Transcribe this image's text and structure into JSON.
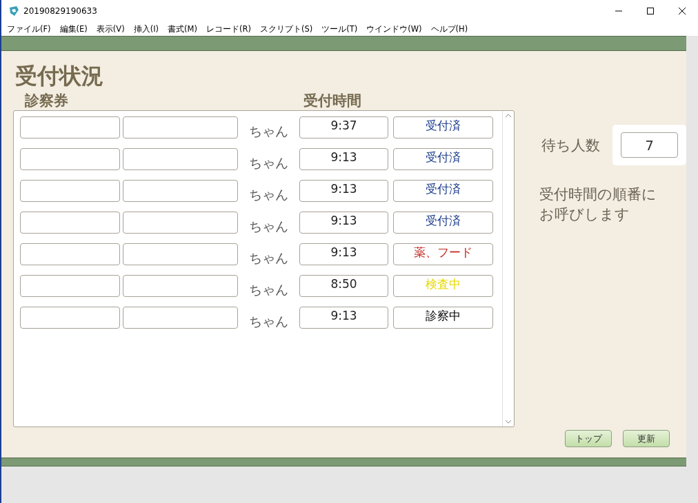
{
  "window": {
    "title": "20190829190633"
  },
  "menu": [
    "ファイル(F)",
    "編集(E)",
    "表示(V)",
    "挿入(I)",
    "書式(M)",
    "レコード(R)",
    "スクリプト(S)",
    "ツール(T)",
    "ウインドウ(W)",
    "ヘルプ(H)"
  ],
  "heading": "受付状況",
  "columns": {
    "card": "診察券",
    "time": "受付時間"
  },
  "rows": [
    {
      "suffix": "ちゃん",
      "time": "9:37",
      "status": "受付済",
      "color": "#1a3a8a"
    },
    {
      "suffix": "ちゃん",
      "time": "9:13",
      "status": "受付済",
      "color": "#1a3a8a"
    },
    {
      "suffix": "ちゃん",
      "time": "9:13",
      "status": "受付済",
      "color": "#1a3a8a"
    },
    {
      "suffix": "ちゃん",
      "time": "9:13",
      "status": "受付済",
      "color": "#1a3a8a"
    },
    {
      "suffix": "ちゃん",
      "time": "9:13",
      "status": "薬、フード",
      "color": "#c0281e"
    },
    {
      "suffix": "ちゃん",
      "time": "8:50",
      "status": "検査中",
      "color": "#e8d800"
    },
    {
      "suffix": "ちゃん",
      "time": "9:13",
      "status": "診察中",
      "color": "#000000"
    }
  ],
  "waiting": {
    "label": "待ち人数",
    "value": "7"
  },
  "note": [
    "受付時間の順番に",
    "お呼びします"
  ],
  "buttons": [
    "トップ",
    "更新"
  ]
}
